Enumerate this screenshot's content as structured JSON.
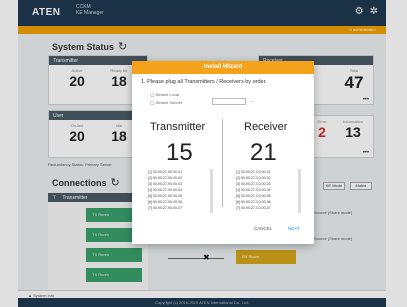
{
  "header": {
    "logo": "ATEN",
    "app_line1": "CCKM",
    "app_line2": "KE Manager",
    "sub_right": "● administrator"
  },
  "system_status": {
    "title": "System Status",
    "transmitter": {
      "label": "Transmitter",
      "cells": [
        {
          "label": "Active",
          "value": "20"
        },
        {
          "label": "Ready for",
          "value": "18"
        }
      ]
    },
    "receiver_right": {
      "label": "Receiver",
      "cells": [
        {
          "label": "Total",
          "value": "47"
        }
      ]
    },
    "user": {
      "label": "User",
      "cells": [
        {
          "label": "On-line",
          "value": "20"
        },
        {
          "label": "Idle",
          "value": "18"
        }
      ]
    },
    "right2": {
      "cells": [
        {
          "label": "Error",
          "value": "2"
        },
        {
          "label": "Information",
          "value": "13"
        }
      ]
    },
    "redundancy": "Redundancy Status: Primary Server"
  },
  "connections": {
    "title": "Connections",
    "col_header": "Transmitter",
    "tx_buttons": [
      "TX Room",
      "TX Room",
      "TX Room",
      "TX Room"
    ],
    "tabs": [
      "KE Mode",
      "Matrix"
    ],
    "right_items": [
      "Source (Share mode)",
      "Source (Share mode)"
    ],
    "rx_box": "RX Room"
  },
  "wizard": {
    "title": "Install Wizard",
    "instruction": "1. Please plug all Transmitters / Receivers by order.",
    "radio_local": "Search Local",
    "radio_subnet": "Search Subnet",
    "transmitter_label": "Transmitter",
    "transmitter_count": "15",
    "receiver_label": "Receiver",
    "receiver_count": "21",
    "tx_list": [
      "[1] 00-90-27-90-00-01",
      "[2] 00-90-27-90-00-02",
      "[3] 00-90-27-90-00-03",
      "[4] 00-90-27-90-00-04",
      "[5] 00-90-27-90-00-05",
      "[6] 00-90-27-90-00-06",
      "[7] 00-90-27-90-00-07"
    ],
    "rx_list": [
      "[1] 00-90-27-C0-00-01",
      "[2] 00-90-27-C0-00-02",
      "[3] 00-90-27-C0-00-03",
      "[4] 00-90-27-C0-00-04",
      "[5] 00-90-27-C0-00-05",
      "[6] 00-90-27-C0-00-06",
      "[7] 00-90-27-C0-00-07"
    ],
    "cancel": "CANCEL",
    "next": "NEXT"
  },
  "footer": {
    "system_info": "▲ System Info",
    "copyright": "Copyright (c) 2016-2019 ATEN International Co., Ltd."
  },
  "colors": {
    "accent": "#f4a21b",
    "header": "#1f3a50",
    "green": "#3aa06b",
    "red": "#d32f2f",
    "link": "#2196f3"
  }
}
